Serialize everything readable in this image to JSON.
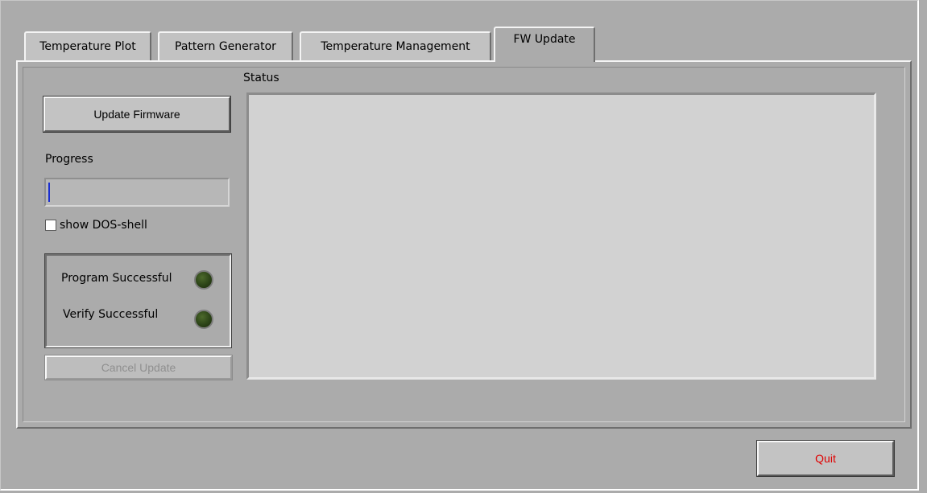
{
  "tabs": [
    {
      "label": "Temperature Plot"
    },
    {
      "label": "Pattern Generator"
    },
    {
      "label": "Temperature Management"
    },
    {
      "label": "FW Update"
    }
  ],
  "active_tab": "FW Update",
  "fw_update": {
    "update_button_label": "Update Firmware",
    "progress_label": "Progress",
    "progress_fraction": 0.0,
    "show_dos_shell_label": "show DOS-shell",
    "show_dos_shell_checked": false,
    "program_successful_label": "Program Successful",
    "verify_successful_label": "Verify Successful",
    "cancel_button_label": "Cancel Update",
    "status_label": "Status",
    "status_text": ""
  },
  "quit_button_label": "Quit",
  "colors": {
    "background": "#ababab",
    "progress_fill": "#1a2fd0",
    "led_off": "#2c4417",
    "quit_text": "#e00000",
    "status_bg": "#d2d2d2"
  }
}
